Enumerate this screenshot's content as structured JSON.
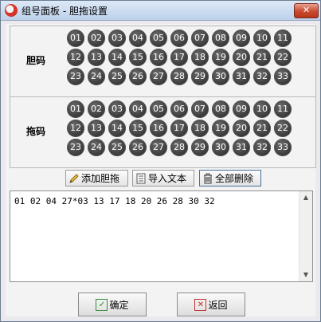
{
  "window": {
    "title": "组号面板 - 胆拖设置",
    "close_label": "✕"
  },
  "groups": [
    {
      "label": "胆码"
    },
    {
      "label": "拖码"
    }
  ],
  "numbers": [
    "01",
    "02",
    "03",
    "04",
    "05",
    "06",
    "07",
    "08",
    "09",
    "10",
    "11",
    "12",
    "13",
    "14",
    "15",
    "16",
    "17",
    "18",
    "19",
    "20",
    "21",
    "22",
    "23",
    "24",
    "25",
    "26",
    "27",
    "28",
    "29",
    "30",
    "31",
    "32",
    "33"
  ],
  "toolbar": {
    "add_label": "添加胆拖",
    "import_label": "导入文本",
    "delete_all_label": "全部删除"
  },
  "textarea": {
    "value": "01 02 04 27*03 13 17 18 20 26 28 30 32"
  },
  "footer": {
    "ok_label": "确定",
    "back_label": "返回"
  },
  "colors": {
    "ball": "#3b3b3b",
    "titlebar": "#c9daee",
    "close": "#c84a30"
  }
}
